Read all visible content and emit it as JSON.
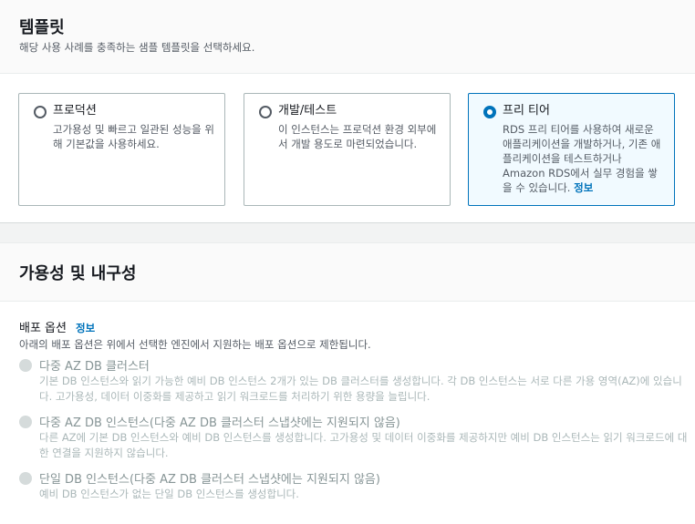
{
  "templates": {
    "title": "템플릿",
    "description": "해당 사용 사례를 충족하는 샘플 템플릿을 선택하세요.",
    "options": [
      {
        "label": "프로덕션",
        "description": "고가용성 및 빠르고 일관된 성능을 위해 기본값을 사용하세요.",
        "selected": false
      },
      {
        "label": "개발/테스트",
        "description": "이 인스턴스는 프로덕션 환경 외부에서 개발 용도로 마련되었습니다.",
        "selected": false
      },
      {
        "label": "프리 티어",
        "description": "RDS 프리 티어를 사용하여 새로운 애플리케이션을 개발하거나, 기존 애플리케이션을 테스트하거나 Amazon RDS에서 실무 경험을 쌓을 수 있습니다.",
        "info": "정보",
        "selected": true
      }
    ]
  },
  "availability": {
    "title": "가용성 및 내구성",
    "deployment_label": "배포 옵션",
    "info_link": "정보",
    "deployment_description": "아래의 배포 옵션은 위에서 선택한 엔진에서 지원하는 배포 옵션으로 제한됩니다.",
    "options": [
      {
        "label": "다중 AZ DB 클러스터",
        "description": "기본 DB 인스턴스와 읽기 가능한 예비 DB 인스턴스 2개가 있는 DB 클러스터를 생성합니다. 각 DB 인스턴스는 서로 다른 가용 영역(AZ)에 있습니다. 고가용성, 데이터 이중화를 제공하고 읽기 워크로드를 처리하기 위한 용량을 늘립니다."
      },
      {
        "label": "다중 AZ DB 인스턴스(다중 AZ DB 클러스터 스냅샷에는 지원되지 않음)",
        "description": "다른 AZ에 기본 DB 인스턴스와 예비 DB 인스턴스를 생성합니다. 고가용성 및 데이터 이중화를 제공하지만 예비 DB 인스턴스는 읽기 워크로드에 대한 연결을 지원하지 않습니다."
      },
      {
        "label": "단일 DB 인스턴스(다중 AZ DB 클러스터 스냅샷에는 지원되지 않음)",
        "description": "예비 DB 인스턴스가 없는 단일 DB 인스턴스를 생성합니다."
      }
    ]
  },
  "colors": {
    "accent": "#0073bb",
    "selected_tile_bg": "#f1faff",
    "disabled_text": "#879596"
  }
}
